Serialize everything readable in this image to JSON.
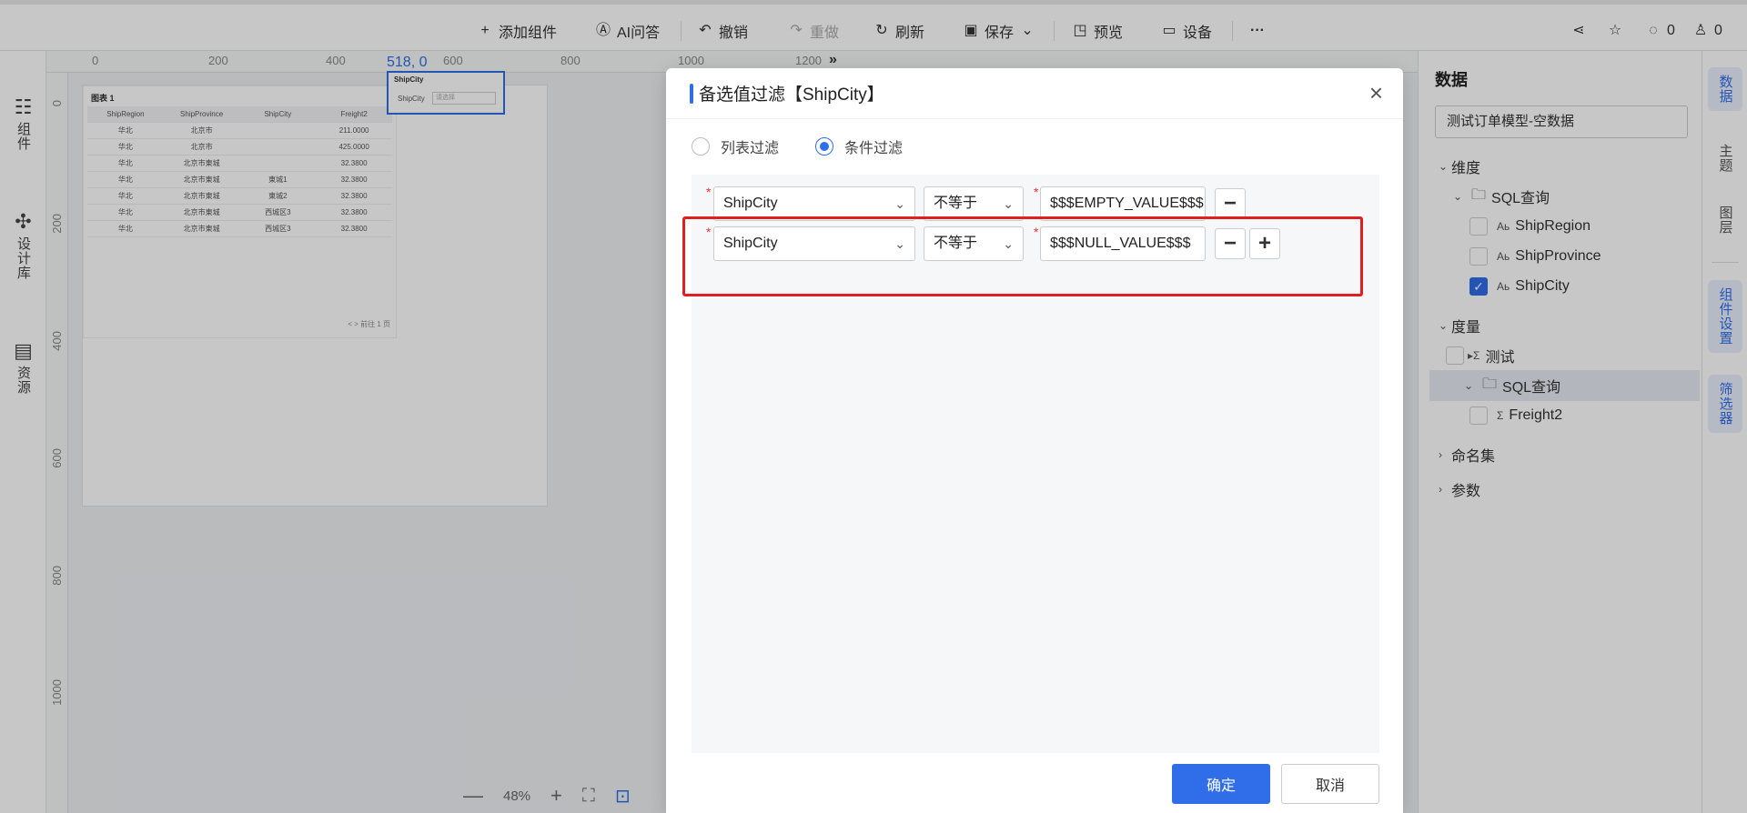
{
  "toolbar": {
    "add_component": "添加组件",
    "ai_qa": "AI问答",
    "undo": "撤销",
    "redo": "重做",
    "refresh": "刷新",
    "save": "保存",
    "preview": "预览",
    "device": "设备",
    "more": "···",
    "comment_count": "0",
    "like_count": "0"
  },
  "left_sidebar": {
    "items": [
      {
        "label": "组件",
        "icon": "components-icon"
      },
      {
        "label": "设计库",
        "icon": "puzzle-icon"
      },
      {
        "label": "资源",
        "icon": "resource-icon"
      }
    ]
  },
  "canvas": {
    "ruler_top": [
      "0",
      "200",
      "400",
      "600",
      "800",
      "1000",
      "1200"
    ],
    "ruler_left": [
      "0",
      "200",
      "400",
      "600",
      "800",
      "1000"
    ],
    "coord_readout": "518, 0",
    "table_title": "图表 1",
    "table_headers": [
      "ShipRegion",
      "ShipProvince",
      "ShipCity",
      "Freight2"
    ],
    "table_rows": [
      [
        "华北",
        "北京市",
        "",
        "211.0000"
      ],
      [
        "华北",
        "北京市",
        "",
        "425.0000"
      ],
      [
        "华北",
        "北京市東城",
        "",
        "32.3800"
      ],
      [
        "华北",
        "北京市東城",
        "東城1",
        "32.3800"
      ],
      [
        "华北",
        "北京市東城",
        "東城2",
        "32.3800"
      ],
      [
        "华北",
        "北京市東城",
        "西城区3",
        "32.3800"
      ],
      [
        "华北",
        "北京市東城",
        "西城区3",
        "32.3800"
      ]
    ],
    "pagination": "< >  前往  1  页",
    "filter_widget_title": "ShipCity",
    "filter_widget_label": "ShipCity",
    "filter_widget_placeholder": "请选择",
    "zoom": "48%"
  },
  "modal": {
    "title": "备选值过滤【ShipCity】",
    "radio_list": "列表过滤",
    "radio_condition": "条件过滤",
    "selected_radio": "condition",
    "conditions": [
      {
        "field": "ShipCity",
        "operator": "不等于",
        "value": "$$$EMPTY_VALUE$$$"
      },
      {
        "field": "ShipCity",
        "operator": "不等于",
        "value": "$$$NULL_VALUE$$$"
      }
    ],
    "confirm": "确定",
    "cancel": "取消"
  },
  "right_panel": {
    "title": "数据",
    "dataset": "测试订单模型-空数据",
    "dimension_group": "维度",
    "dimension_folder": "SQL查询",
    "dimensions": [
      {
        "name": "ShipRegion",
        "checked": false
      },
      {
        "name": "ShipProvince",
        "checked": false
      },
      {
        "name": "ShipCity",
        "checked": true
      }
    ],
    "measure_group": "度量",
    "measure_test": "测试",
    "measure_folder": "SQL查询",
    "measures": [
      {
        "name": "Freight2",
        "checked": false
      }
    ],
    "named_sets": "命名集",
    "parameters": "参数"
  },
  "right_rail": {
    "tabs": [
      "数据",
      "主题",
      "图层",
      "组件设置",
      "筛选器"
    ],
    "active": "数据"
  },
  "colors": {
    "accent": "#2f6ee8",
    "highlight_border": "#e02020"
  }
}
